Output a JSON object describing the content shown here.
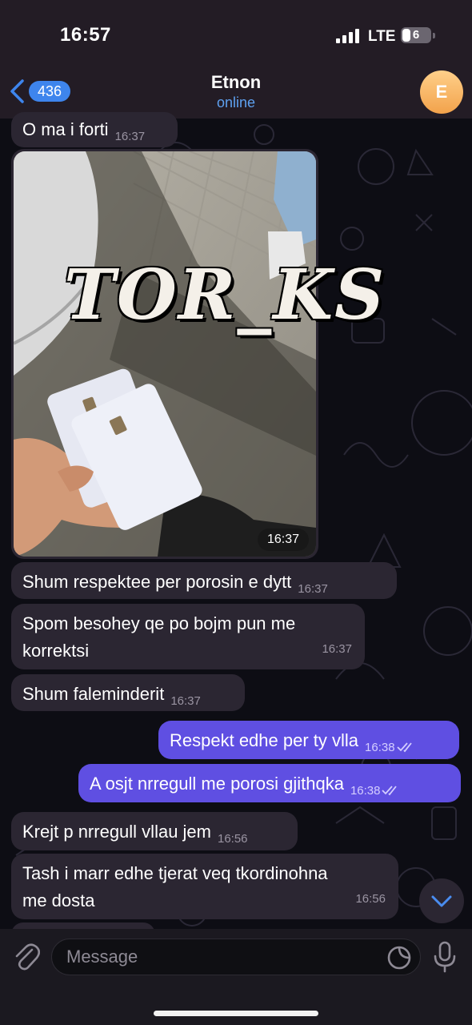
{
  "status_bar": {
    "time": "16:57",
    "network": "LTE",
    "battery": "6"
  },
  "header": {
    "back_count": "436",
    "title": "Etnon",
    "status": "online",
    "avatar_initial": "E"
  },
  "photo_message": {
    "watermark": "TOR_KS",
    "time": "16:37"
  },
  "messages": [
    {
      "text": "O ma i forti",
      "time": "16:37",
      "direction": "in"
    },
    {
      "text": "Shum respektee per porosin  e dytt",
      "time": "16:37",
      "direction": "in"
    },
    {
      "line1": "Spom besohey  qe po bojm pun me",
      "line2": "korrektsi",
      "time": "16:37",
      "direction": "in"
    },
    {
      "text": "Shum faleminderit",
      "time": "16:37",
      "direction": "in"
    },
    {
      "text": "Respekt edhe per ty vlla",
      "time": "16:38",
      "direction": "out"
    },
    {
      "text": "A osjt nrregull me porosi gjithqka",
      "time": "16:38",
      "direction": "out"
    },
    {
      "text": "Krejt p nrregull vllau jem",
      "time": "16:56",
      "direction": "in"
    },
    {
      "line1": "Tash i marr edhe tjerat veq tkordinohna",
      "line2": "me dosta",
      "time": "16:56",
      "direction": "in"
    }
  ],
  "input": {
    "placeholder": "Message"
  },
  "colors": {
    "incoming_bubble": "#2b2632",
    "outgoing_bubble": "#5f4fe2",
    "accent": "#3e85ed",
    "header_bg": "#231c25"
  },
  "icons": [
    "back-chevron-icon",
    "signal-icon",
    "battery-icon",
    "read-check-icon",
    "scroll-down-icon",
    "paperclip-icon",
    "sticker-icon",
    "microphone-icon"
  ]
}
